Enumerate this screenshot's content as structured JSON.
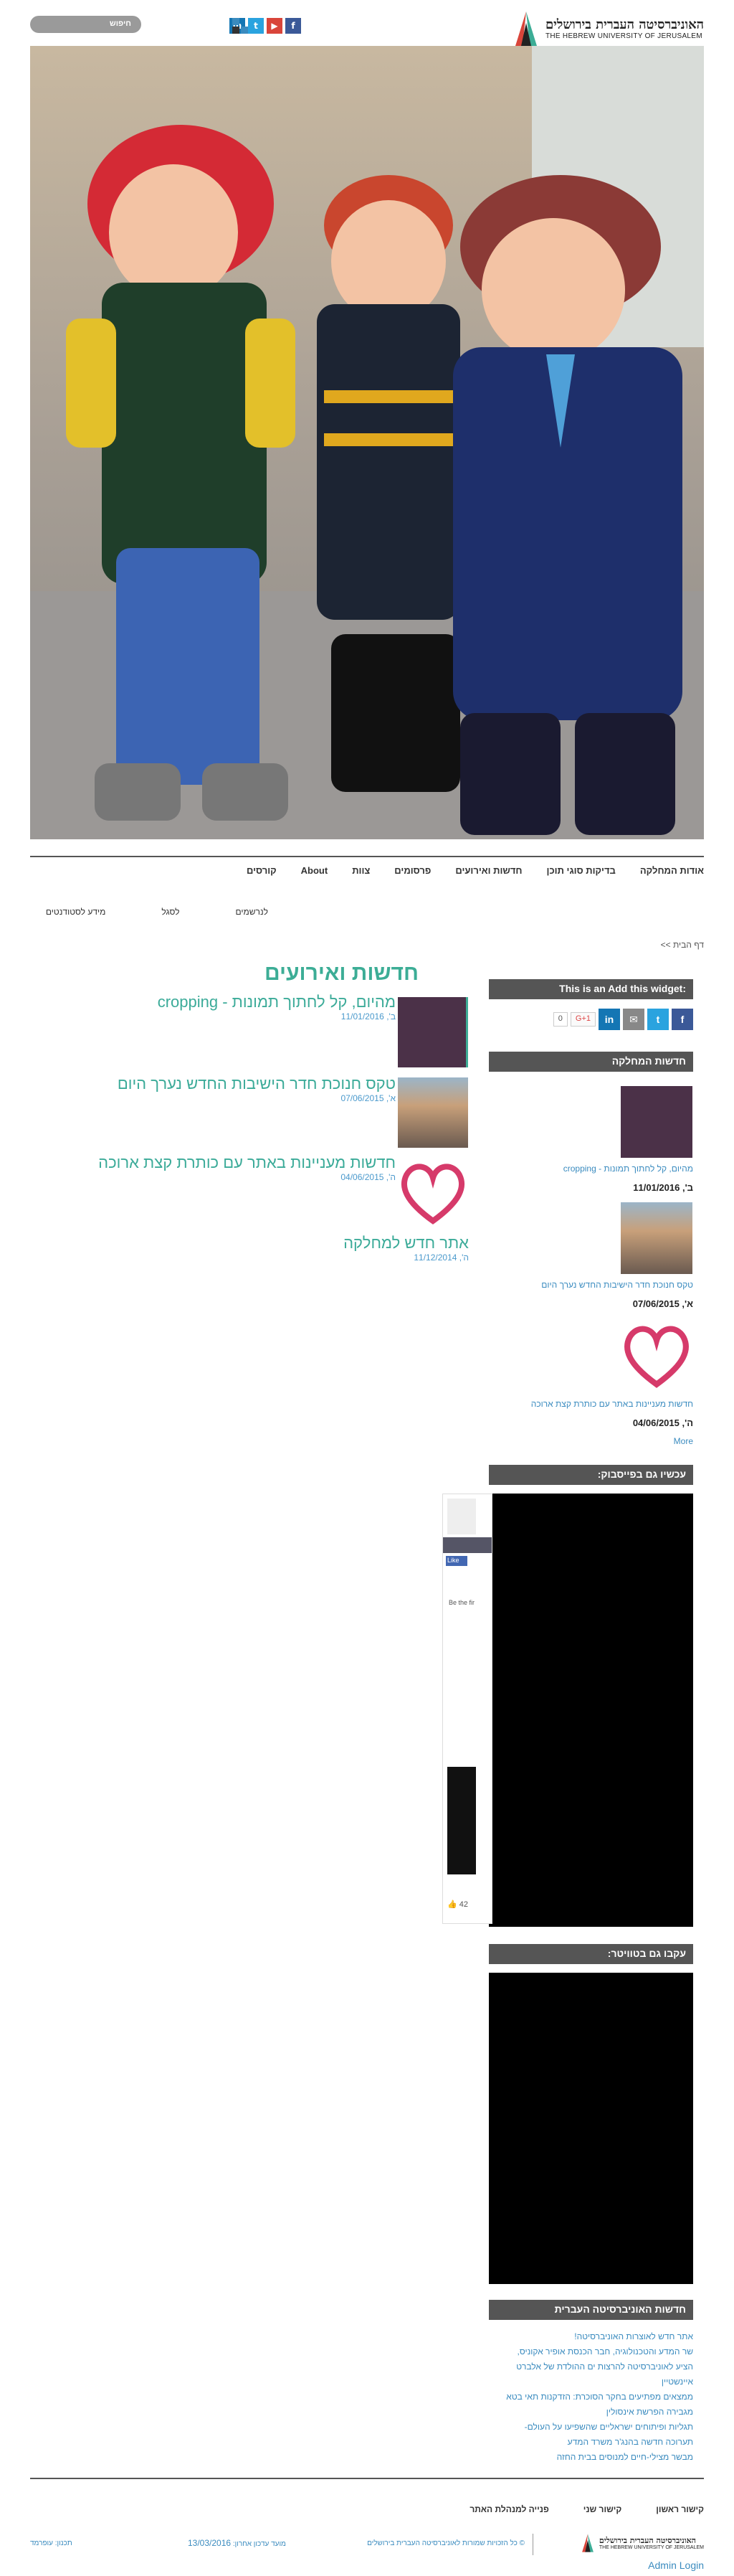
{
  "header": {
    "logo_hebrew": "האוניברסיטה העברית בירושלים",
    "logo_english": "THE HEBREW UNIVERSITY OF JERUSALEM",
    "search_label": "חיפוש",
    "social": [
      {
        "icon": "facebook-icon",
        "glyph": "f",
        "color": "#3b5998"
      },
      {
        "icon": "youtube-icon",
        "glyph": "▶",
        "color": "#d9453a"
      },
      {
        "icon": "twitter-icon",
        "glyph": "t",
        "color": "#2aa3df"
      },
      {
        "icon": "linkedin-icon",
        "glyph": "in",
        "color": "#1476b4"
      }
    ]
  },
  "nav": {
    "main": [
      "אודות המחלקה",
      "בדיקות סוגי תוכן",
      "חדשות ואירועים",
      "פרסומים",
      "צוות",
      "About",
      "קורסים"
    ],
    "sub": [
      "לנרשמים",
      "לסגל",
      "מידע לסטודנטים"
    ]
  },
  "breadcrumb": "דף הבית >>",
  "news": {
    "section_title": "חדשות ואירועים",
    "items": [
      {
        "title": "מהיום, קל לחתוך תמונות - cropping",
        "date": "ב', 11/01/2016"
      },
      {
        "title": "טקס חנוכת חדר הישיבות החדש נערך היום",
        "date": "א', 07/06/2015"
      },
      {
        "title": "חדשות מעניינות באתר עם כותרת קצת ארוכה",
        "date": "ה', 04/06/2015"
      },
      {
        "title": "אתר חדש למחלקה",
        "date": "ה', 11/12/2014"
      }
    ]
  },
  "sidebar": {
    "widget_title": "This is an Add this widget:",
    "gplus_label": "G+1",
    "gplus_count": "0",
    "dept_news_title": "חדשות המחלקה",
    "dept_news": [
      {
        "title": "מהיום, קל לחתוך תמונות - cropping",
        "date": "ב', 11/01/2016"
      },
      {
        "title": "טקס חנוכת חדר הישיבות החדש נערך היום",
        "date": "א', 07/06/2015"
      },
      {
        "title": "חדשות מעניינות באתר עם כותרת קצת ארוכה",
        "date": "ה', 04/06/2015"
      }
    ],
    "more_label": "More",
    "facebook_title": "עכשיו גם בפייסבוק:",
    "fb_like_label": "Like",
    "fb_be_first": "Be the fir",
    "fb_count": "42",
    "twitter_title": "עקבו גם בטוויטר:",
    "huji_title": "חדשות האוניברסיטה העברית",
    "huji_links": [
      "אתר חדש לאוצרות האוניברסיטה!",
      "שר המדע והטכנולוגיה, חבר הכנסת אופיר אקוניס,",
      "הציע לאוניברסיטה להרצות ים ההולדת של אלברט",
      "איינשטיין",
      "ממצאים מפתיעים בחקר הסוכרת: הזדקנות תאי בטא",
      "מגבירה הפרשת אינסולין",
      "תגליות ופיתוחים ישראליים שהשפיעו על העולם-",
      "תערוכה חדשה בהנג'ר משרד המדע",
      "מבשר מצילי-חיים למנוסים בבית החזה"
    ]
  },
  "footer": {
    "links": [
      "קישור ראשון",
      "קישור שני",
      "פנייה למנהלת האתר"
    ],
    "copyright": "© כל הזכויות שמורות לאוניברסיטה העברית בירושלים",
    "updated_label": "מועד עדכון אחרון:",
    "updated_date": "13/03/2016",
    "credit": "תכנון: עופרמד"
  },
  "admin_login": "Admin Login"
}
